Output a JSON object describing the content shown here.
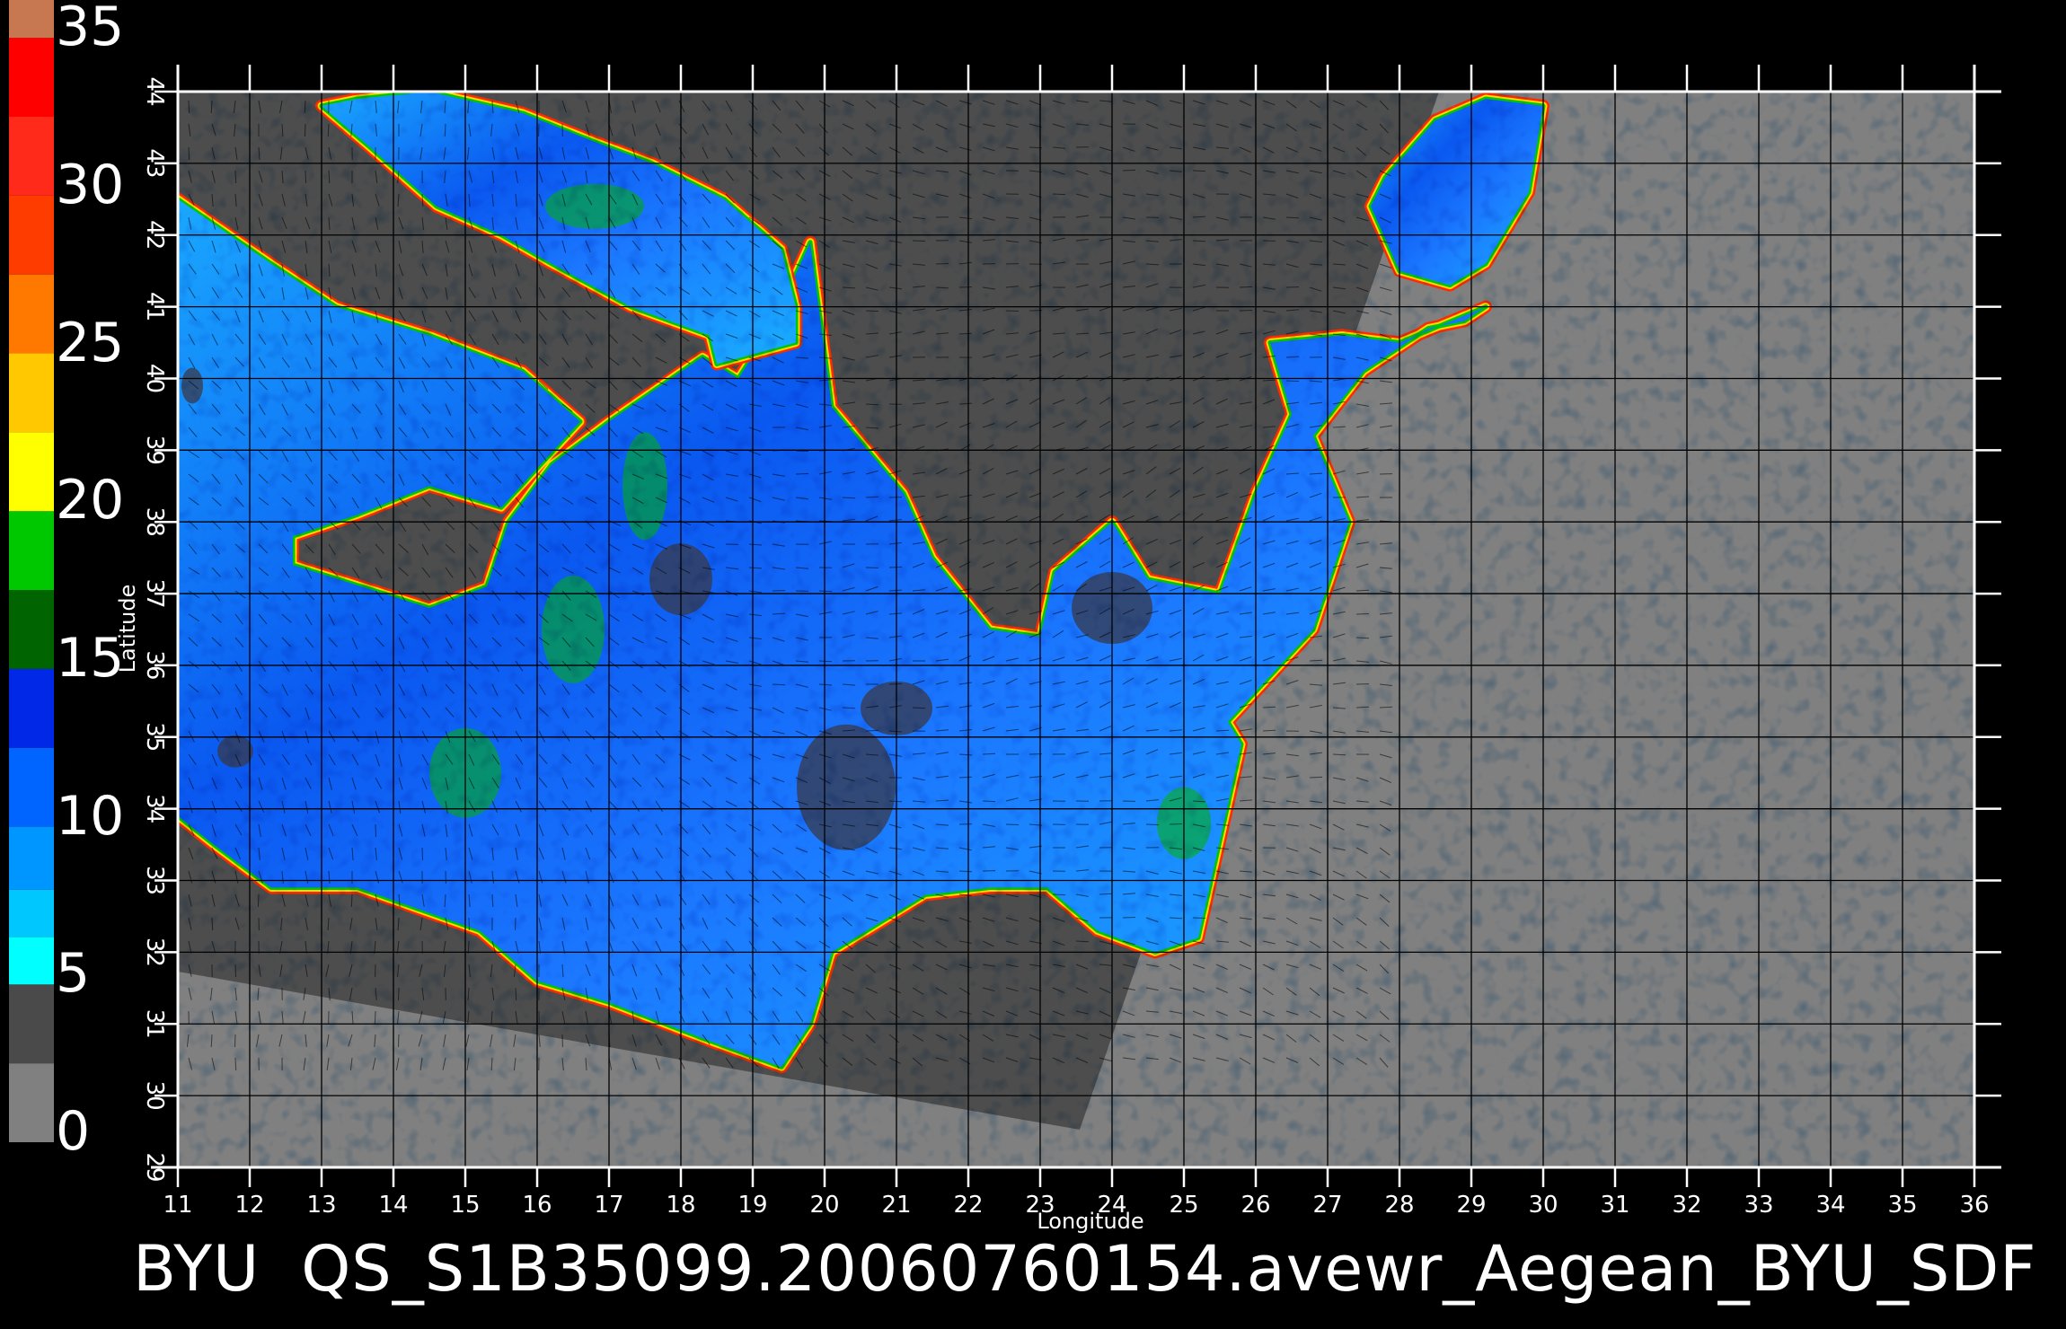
{
  "colorbar": {
    "labels": [
      "35",
      "30",
      "25",
      "20",
      "15",
      "10",
      "5",
      "0"
    ],
    "values": [
      35,
      30,
      25,
      20,
      15,
      10,
      5,
      0
    ]
  },
  "map": {
    "longitude_ticks": [
      "11",
      "12",
      "13",
      "14",
      "15",
      "16",
      "17",
      "18",
      "19",
      "20",
      "21",
      "22",
      "23",
      "24",
      "25",
      "26",
      "27",
      "28",
      "29",
      "30",
      "31",
      "32",
      "33",
      "34",
      "35",
      "36"
    ],
    "latitude_ticks": [
      "29",
      "30",
      "31",
      "32",
      "33",
      "34",
      "35",
      "36",
      "37",
      "38",
      "39",
      "40",
      "41",
      "42",
      "43",
      "44"
    ],
    "xlabel": "Longitude",
    "ylabel": "Latitude",
    "lon_range": [
      11,
      36
    ],
    "lat_range": [
      29,
      44
    ]
  },
  "caption": {
    "prefix": "BYU",
    "filename": "QS_S1B35099.20060760154.avewr_Aegean_BYU_SDF"
  },
  "colors": {
    "background": "#000000",
    "land": "#4d4d4d",
    "no_data": "#808080",
    "grid": "#000000"
  }
}
